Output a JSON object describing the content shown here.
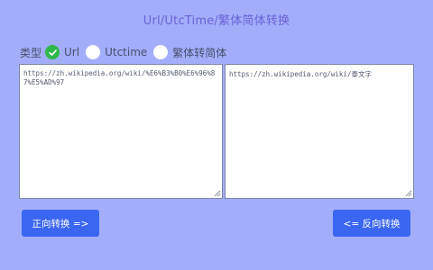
{
  "header": {
    "title_part1": "Url/UtcTime/",
    "title_part2": "繁体简体转换"
  },
  "type_selector": {
    "label": "类型",
    "options": [
      {
        "label": "Url",
        "checked": true
      },
      {
        "label": "Utctime",
        "checked": false
      },
      {
        "label": "繁体转简体",
        "checked": false
      }
    ]
  },
  "inputs": {
    "left_text": "https://zh.wikipedia.org/wiki/%E6%B3%B0%E6%96%87%E5%AD%97",
    "right_text": "https://zh.wikipedia.org/wiki/泰文字"
  },
  "buttons": {
    "forward_label": "正向转换 =>",
    "reverse_label": "<= 反向转换"
  },
  "colors": {
    "background": "#a2aefa",
    "title": "#6a62d6",
    "button": "#3a66f2",
    "check": "#2fb94b"
  }
}
